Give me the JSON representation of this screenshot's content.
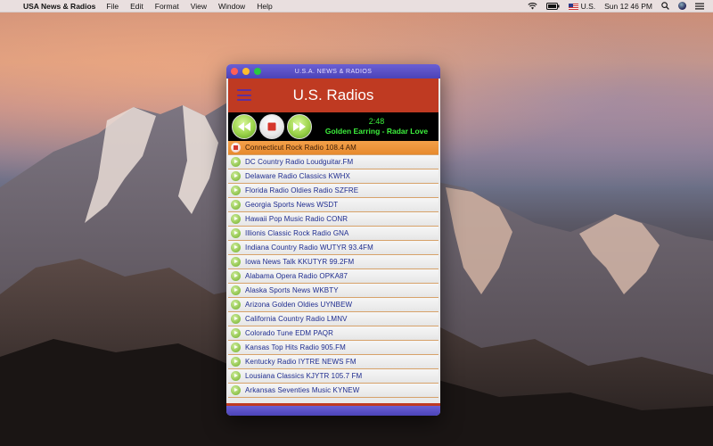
{
  "menubar": {
    "app_name": "USA News & Radios",
    "menus": [
      "File",
      "Edit",
      "Format",
      "View",
      "Window",
      "Help"
    ],
    "status": {
      "input_source": "U.S.",
      "clock": "Sun 12 46 PM"
    }
  },
  "window": {
    "title": "U.S.A. NEWS & RADIOS",
    "header_title": "U.S. Radios",
    "player": {
      "time": "2:48",
      "now_playing": "Golden Earring - Radar Love"
    },
    "stations": [
      {
        "label": "Connecticut Rock Radio 108.4 AM",
        "active": true
      },
      {
        "label": "DC Country Radio Loudguitar.FM"
      },
      {
        "label": "Delaware Radio Classics KWHX"
      },
      {
        "label": "Florida Radio Oldies Radio SZFRE"
      },
      {
        "label": "Georgia Sports News WSDT"
      },
      {
        "label": "Hawaii Pop Music Radio CONR"
      },
      {
        "label": "Illionis Classic Rock Radio GNA"
      },
      {
        "label": "Indiana Country Radio WUTYR 93.4FM"
      },
      {
        "label": "Iowa News Talk KKUTYR 99.2FM"
      },
      {
        "label": "Alabama Opera Radio OPKA87"
      },
      {
        "label": "Alaska Sports News WKBTY"
      },
      {
        "label": "Arizona Golden Oldies UYNBEW"
      },
      {
        "label": "California Country Radio LMNV"
      },
      {
        "label": "Colorado Tune EDM PAQR"
      },
      {
        "label": "Kansas Top Hits Radio 905.FM"
      },
      {
        "label": "Kentucky Radio IYTRE NEWS FM"
      },
      {
        "label": "Lousiana Classics KJYTR 105.7 FM"
      },
      {
        "label": "Arkansas Seventies Music KYNEW"
      }
    ]
  },
  "colors": {
    "header_red": "#bf3a22",
    "title_purple": "#4b43b8",
    "active_orange": "#e78a2d",
    "now_playing_green": "#3cf03c",
    "station_text": "#1d2b8f"
  },
  "icons": {
    "rewind": "rewind-icon",
    "stop": "stop-icon",
    "forward": "fast-forward-icon",
    "station_play": "play-icon",
    "station_stop": "stop-icon"
  }
}
